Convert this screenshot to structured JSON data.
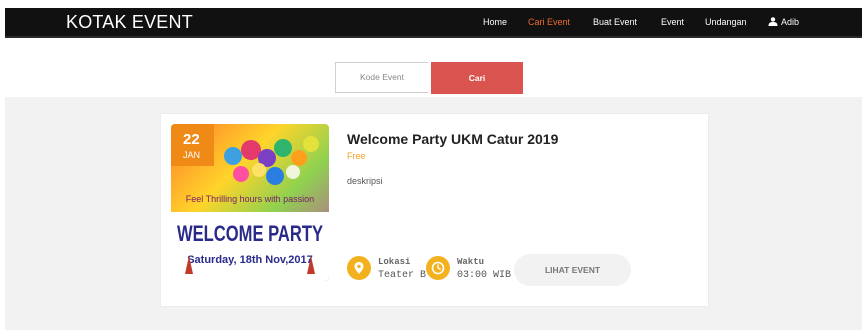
{
  "nav": {
    "brand": "KOTAK EVENT",
    "items": [
      {
        "label": "Home",
        "active": false
      },
      {
        "label": "Cari Event",
        "active": true
      },
      {
        "label": "Buat Event",
        "active": false
      },
      {
        "label": "Event",
        "active": false
      },
      {
        "label": "Undangan",
        "active": false
      }
    ],
    "user": "Adib"
  },
  "search": {
    "placeholder": "Kode Event",
    "button_label": "Cari"
  },
  "event": {
    "date_day": "22",
    "date_month": "JAN",
    "title": "Welcome Party UKM Catur 2019",
    "price": "Free",
    "description": "deskripsi",
    "location_label": "Lokasi",
    "location_value": "Teater B",
    "time_label": "Waktu",
    "time_value": "03:00 WIB",
    "view_button": "LIHAT EVENT",
    "poster": {
      "line1": "Feel Thrilling hours with passion",
      "line2": "WELCOME PARTY",
      "line3": "Saturday, 18th Nov,2017"
    }
  },
  "colors": {
    "accent": "#ef6c2c",
    "badge": "#ef8a16",
    "search_button": "#d9534f",
    "meta_icon": "#f3b21d",
    "price": "#f0a12a"
  }
}
